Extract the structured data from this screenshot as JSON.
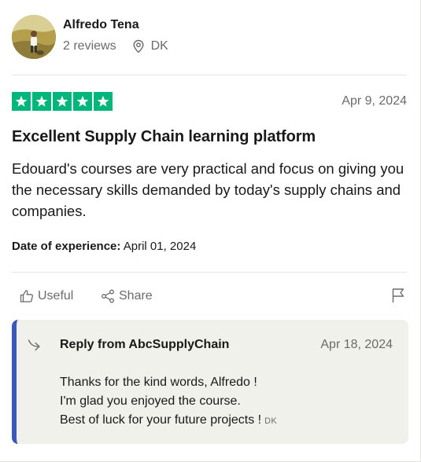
{
  "consumer": {
    "name": "Alfredo Tena",
    "reviews": "2 reviews",
    "country": "DK"
  },
  "review": {
    "rating": 5,
    "date": "Apr 9, 2024",
    "title": "Excellent Supply Chain learning platform",
    "body": "Edouard's courses are very practical and focus on giving you the necessary skills demanded by today's supply chains and companies.",
    "experience_label": "Date of experience:",
    "experience_date": "April 01, 2024"
  },
  "actions": {
    "useful_label": "Useful",
    "share_label": "Share"
  },
  "reply": {
    "from": "Reply from AbcSupplyChain",
    "date": "Apr 18, 2024",
    "lines": [
      "Thanks for the kind words, Alfredo !",
      "I'm glad you enjoyed the course.",
      "Best of luck for your future projects !"
    ],
    "lang_tag": "DK"
  },
  "colors": {
    "star_green": "#00b67a",
    "reply_accent": "#3c57bc",
    "reply_bg": "#f1f1ec",
    "muted_text": "#6b6b6b"
  },
  "icons": {
    "avatar": "user-photo",
    "location": "location-pin-icon",
    "star": "star-icon",
    "useful": "thumbs-up-icon",
    "share": "share-icon",
    "flag": "flag-icon",
    "reply": "reply-arrow-icon"
  }
}
